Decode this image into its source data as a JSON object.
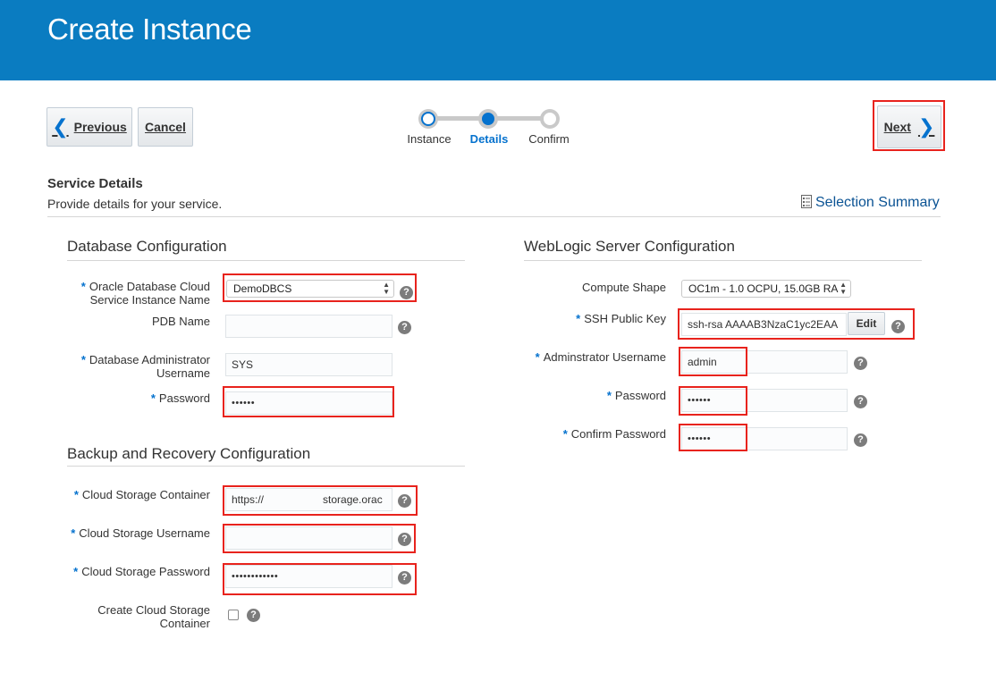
{
  "header": {
    "title": "Create Instance"
  },
  "nav": {
    "previous_label": "Previous",
    "cancel_label": "Cancel",
    "next_label": "Next"
  },
  "train": {
    "steps": [
      {
        "label": "Instance",
        "state": "visited"
      },
      {
        "label": "Details",
        "state": "current"
      },
      {
        "label": "Confirm",
        "state": "unvisited"
      }
    ]
  },
  "service_details": {
    "title": "Service Details",
    "description": "Provide details for your service.",
    "selection_summary_label": "Selection Summary"
  },
  "database_config": {
    "title": "Database Configuration",
    "instance_name_label": "Oracle Database Cloud Service Instance Name",
    "instance_name_value": "DemoDBCS",
    "pdb_name_label": "PDB Name",
    "pdb_name_value": "",
    "admin_username_label": "Database Administrator Username",
    "admin_username_value": "SYS",
    "password_label": "Password",
    "password_value": "••••••"
  },
  "backup_config": {
    "title": "Backup and Recovery Configuration",
    "storage_container_label": "Cloud Storage Container",
    "storage_container_value_prefix": "https://",
    "storage_container_value_suffix": "storage.orac",
    "storage_username_label": "Cloud Storage Username",
    "storage_username_value": "",
    "storage_password_label": "Cloud Storage Password",
    "storage_password_value": "••••••••••••",
    "create_container_label": "Create Cloud Storage Container",
    "create_container_checked": false
  },
  "weblogic_config": {
    "title": "WebLogic Server Configuration",
    "compute_shape_label": "Compute Shape",
    "compute_shape_value": "OC1m - 1.0 OCPU, 15.0GB RA",
    "ssh_key_label": "SSH Public Key",
    "ssh_key_value": "ssh-rsa AAAAB3NzaC1yc2EAA",
    "ssh_edit_label": "Edit",
    "admin_username_label": "Adminstrator Username",
    "admin_username_value": "admin",
    "password_label": "Password",
    "password_value": "••••••",
    "confirm_password_label": "Confirm Password",
    "confirm_password_value": "••••••"
  },
  "colors": {
    "banner": "#0a7cc1",
    "accent": "#0572ce",
    "highlight": "#e8231d"
  },
  "icons": {
    "help": "?",
    "chevron_left": "‹",
    "chevron_right": "›"
  }
}
